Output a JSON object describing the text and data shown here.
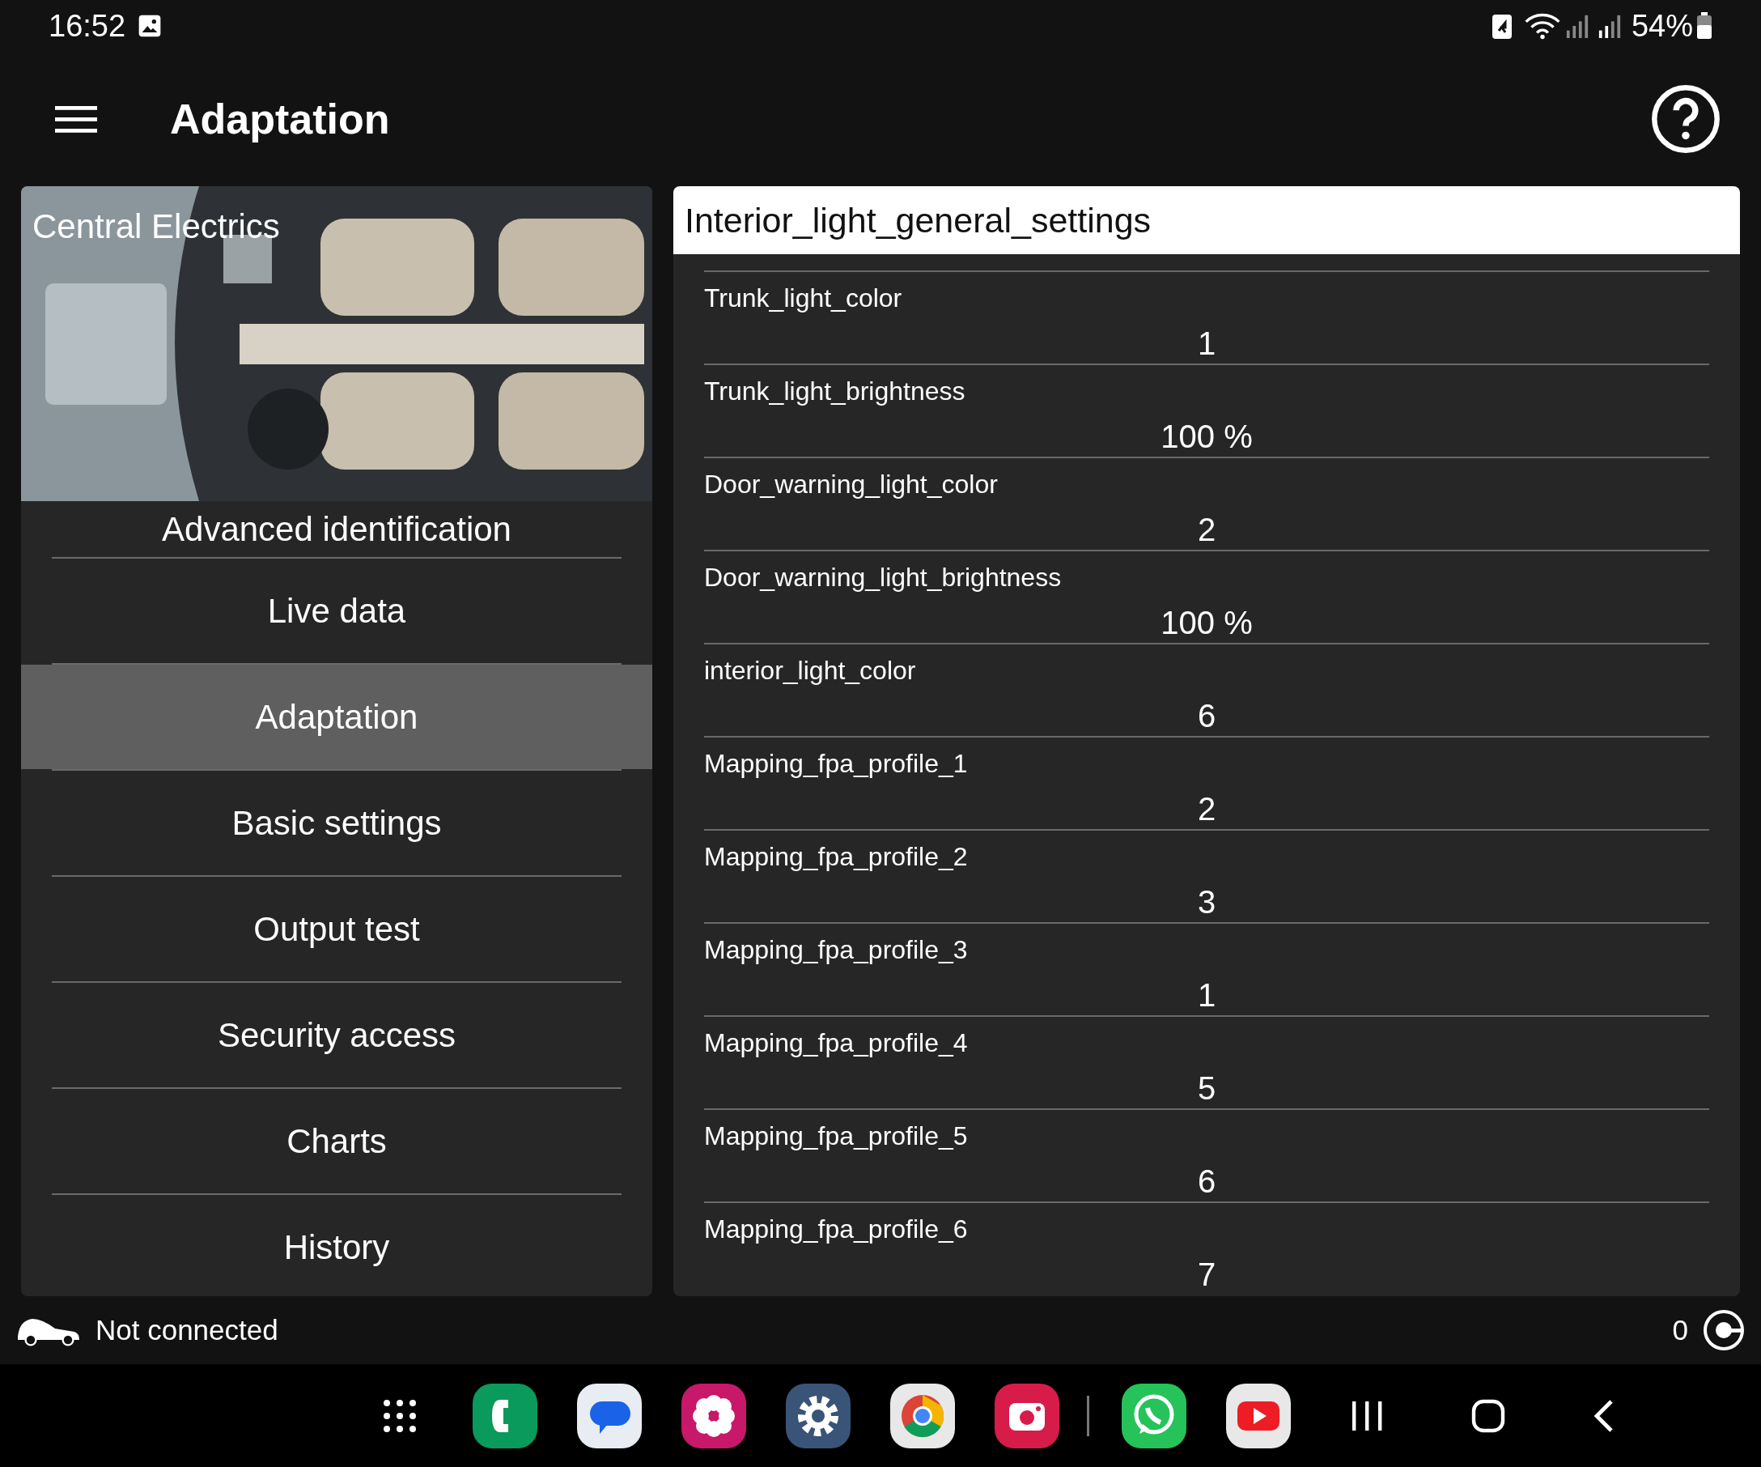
{
  "status_bar": {
    "time": "16:52",
    "battery": "54%"
  },
  "app_bar": {
    "title": "Adaptation"
  },
  "side_panel": {
    "header": "Central Electrics",
    "items": [
      {
        "label": "Advanced identification",
        "selected": false
      },
      {
        "label": "Live data",
        "selected": false
      },
      {
        "label": "Adaptation",
        "selected": true
      },
      {
        "label": "Basic settings",
        "selected": false
      },
      {
        "label": "Output test",
        "selected": false
      },
      {
        "label": "Security access",
        "selected": false
      },
      {
        "label": "Charts",
        "selected": false
      },
      {
        "label": "History",
        "selected": false
      }
    ]
  },
  "adaptation_panel": {
    "title": "Interior_light_general_settings",
    "rows": [
      {
        "name": "Trunk_light_color",
        "value": "1"
      },
      {
        "name": "Trunk_light_brightness",
        "value": "100 %"
      },
      {
        "name": "Door_warning_light_color",
        "value": "2"
      },
      {
        "name": "Door_warning_light_brightness",
        "value": "100 %"
      },
      {
        "name": "interior_light_color",
        "value": "6"
      },
      {
        "name": "Mapping_fpa_profile_1",
        "value": "2"
      },
      {
        "name": "Mapping_fpa_profile_2",
        "value": "3"
      },
      {
        "name": "Mapping_fpa_profile_3",
        "value": "1"
      },
      {
        "name": "Mapping_fpa_profile_4",
        "value": "5"
      },
      {
        "name": "Mapping_fpa_profile_5",
        "value": "6"
      },
      {
        "name": "Mapping_fpa_profile_6",
        "value": "7"
      }
    ]
  },
  "connection_bar": {
    "status": "Not connected",
    "count": "0"
  }
}
